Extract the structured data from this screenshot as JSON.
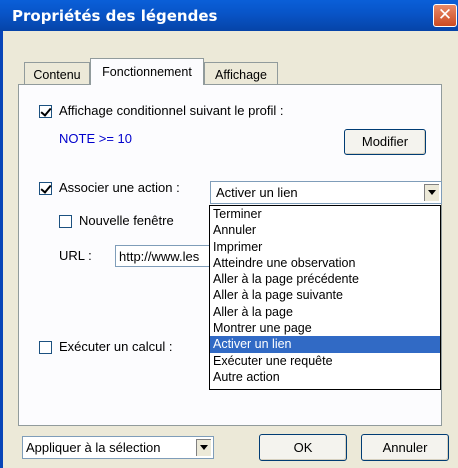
{
  "window": {
    "title": "Propriétés des légendes",
    "close_label": "✕"
  },
  "tabs": [
    {
      "label": "Contenu"
    },
    {
      "label": "Fonctionnement"
    },
    {
      "label": "Affichage"
    }
  ],
  "conditional": {
    "checkbox_label": "Affichage conditionnel suivant le profil :",
    "checked": true,
    "expression": "NOTE >= 10",
    "expression_color": "#0000cc",
    "modify_label": "Modifier"
  },
  "action": {
    "checkbox_label": "Associer une action :",
    "checked": true,
    "selected": "Activer un lien",
    "options": [
      "Terminer",
      "Annuler",
      "Imprimer",
      "Atteindre une observation",
      "Aller à la page précédente",
      "Aller à la page suivante",
      "Aller à la page",
      "Montrer une page",
      "Activer un lien",
      "Exécuter une requête",
      "Autre action"
    ],
    "new_window_label": "Nouvelle fenêtre",
    "new_window_checked": false,
    "url_label": "URL :",
    "url_value": "http://www.les"
  },
  "calc": {
    "checkbox_label": "Exécuter un calcul :",
    "checked": false
  },
  "footer": {
    "apply_scope": "Appliquer à la sélection",
    "ok_label": "OK",
    "cancel_label": "Annuler"
  },
  "colors": {
    "title_bar": "#0855c9",
    "selection": "#316ac5"
  }
}
